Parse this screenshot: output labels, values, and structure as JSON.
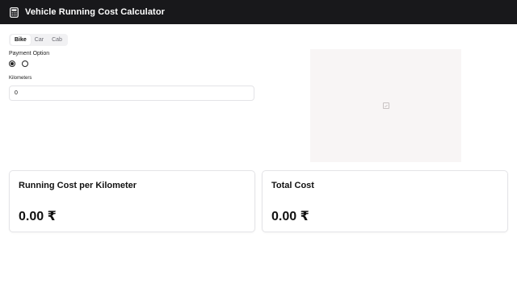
{
  "header": {
    "title": "Vehicle Running Cost Calculator",
    "icon": "calculator-icon"
  },
  "tabs": [
    {
      "label": "Bike",
      "active": true
    },
    {
      "label": "Car",
      "active": false
    },
    {
      "label": "Cab",
      "active": false
    }
  ],
  "payment": {
    "label": "Payment Option",
    "selected_index": 0
  },
  "kilometers": {
    "label": "Kilometers",
    "value": "0"
  },
  "image_placeholder": {
    "icon": "broken-image-icon"
  },
  "results": {
    "per_km": {
      "title": "Running Cost per Kilometer",
      "value": "0.00 ₹"
    },
    "total": {
      "title": "Total Cost",
      "value": "0.00 ₹"
    }
  },
  "colors": {
    "header_bg": "#18181b",
    "image_bg": "#f8f5f5"
  }
}
